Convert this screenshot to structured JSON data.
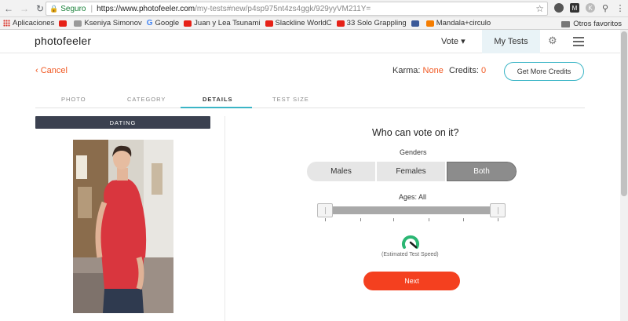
{
  "browser": {
    "security_label": "Seguro",
    "url_host": "https://www.photofeeler.com",
    "url_path": "/my-tests#new/p4sp975nt4zs4ggk/929yyVM211Y="
  },
  "bookmarks": {
    "apps_label": "Aplicaciones",
    "items": [
      {
        "label": "",
        "icon": "youtube-icon"
      },
      {
        "label": "Kseniya Simonov",
        "icon": "bookmark-favicon"
      },
      {
        "label": "Google",
        "icon": "google-icon"
      },
      {
        "label": "Juan y Lea Tsunami",
        "icon": "youtube-icon"
      },
      {
        "label": "Slackline WorldC",
        "icon": "youtube-icon"
      },
      {
        "label": "33 Solo Grappling",
        "icon": "youtube-icon"
      },
      {
        "label": "",
        "icon": "facebook-icon"
      },
      {
        "label": "Mandala+circulo",
        "icon": "blogger-icon"
      }
    ],
    "other_label": "Otros favoritos"
  },
  "nav": {
    "logo": "photofeeler",
    "vote": "Vote ▾",
    "my_tests": "My Tests"
  },
  "header": {
    "cancel": "‹ Cancel",
    "karma_label": "Karma:",
    "karma_value": "None",
    "credits_label": "Credits:",
    "credits_value": "0",
    "more_credits": "Get More Credits"
  },
  "tabs": [
    "PHOTO",
    "CATEGORY",
    "DETAILS",
    "TEST SIZE"
  ],
  "active_tab": "DETAILS",
  "category_badge": "DATING",
  "form": {
    "title": "Who can vote on it?",
    "genders_label": "Genders",
    "gender_options": [
      "Males",
      "Females",
      "Both"
    ],
    "gender_selected": "Both",
    "ages_label": "Ages: All",
    "speed_label": "(Estimated Test Speed)",
    "next_label": "Next"
  },
  "colors": {
    "accent_orange": "#f15a24",
    "accent_teal": "#3bb5c6",
    "next_button": "#f4401f",
    "dating_badge": "#3b4150",
    "speed_gauge": "#2bb673"
  }
}
